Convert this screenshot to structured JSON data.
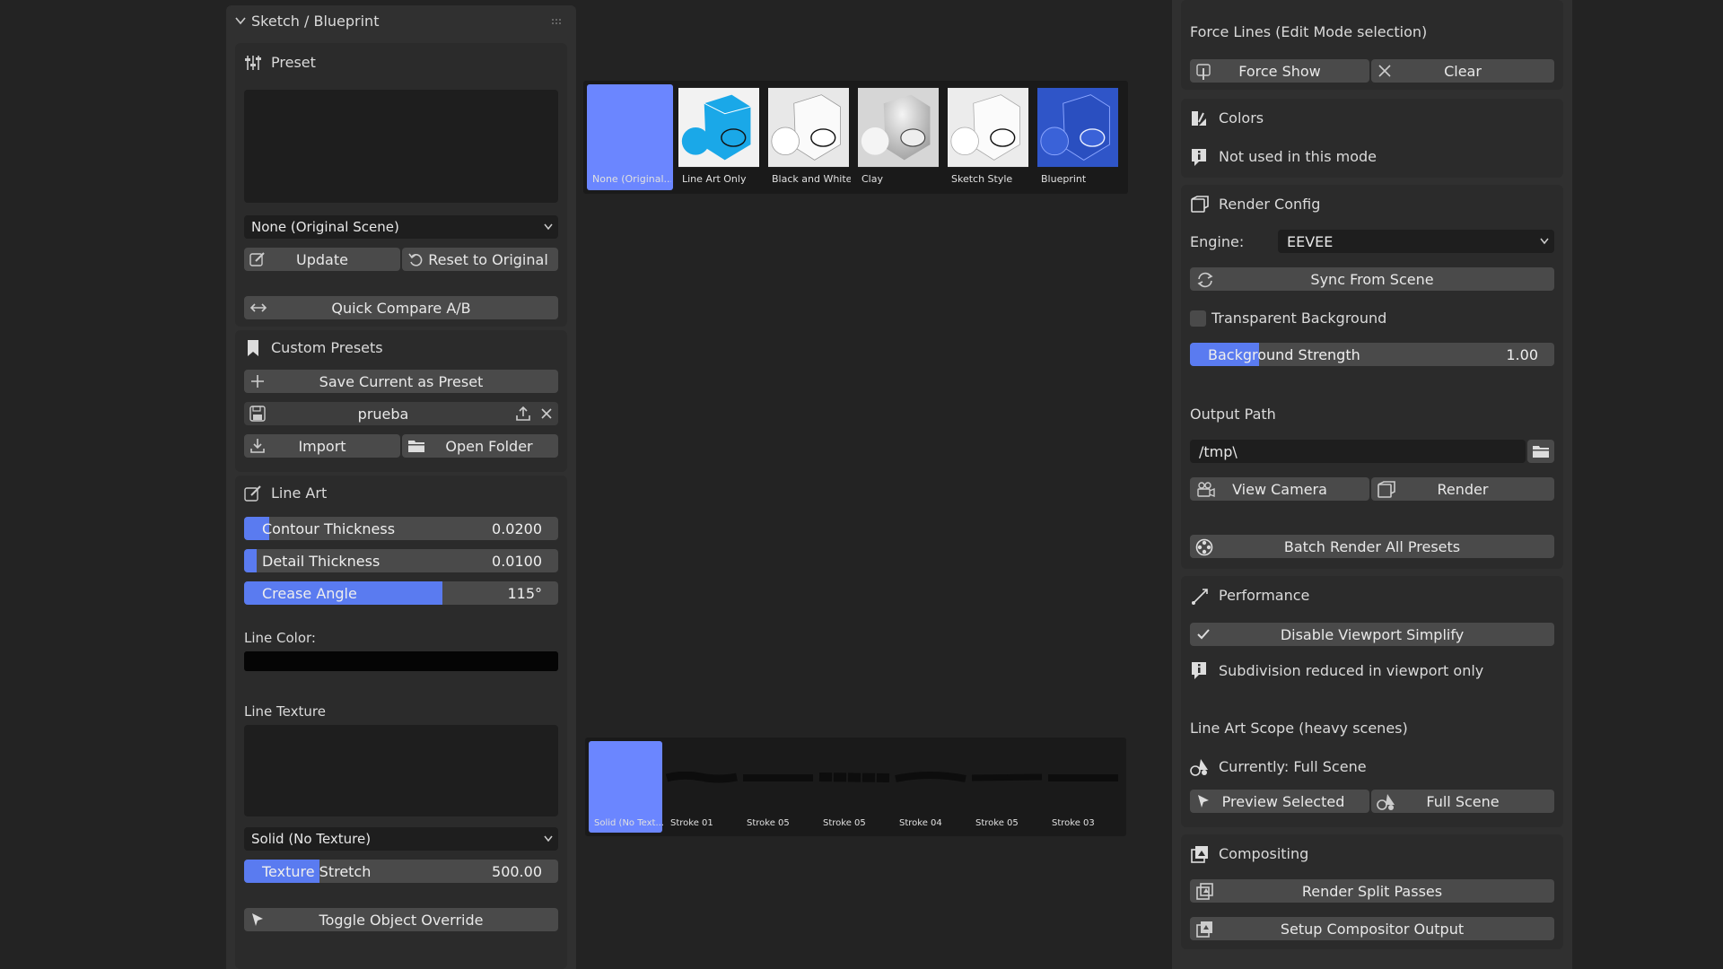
{
  "left_panel": {
    "title": "Sketch / Blueprint",
    "preset": {
      "header": "Preset",
      "dropdown_value": "None (Original Scene)",
      "update_label": "Update",
      "reset_label": "Reset to Original",
      "compare_label": "Quick Compare A/B"
    },
    "custom_presets": {
      "header": "Custom Presets",
      "save_label": "Save Current as Preset",
      "preset_name": "prueba",
      "import_label": "Import",
      "open_folder_label": "Open Folder"
    },
    "line_art": {
      "header": "Line Art",
      "sliders": [
        {
          "label": "Contour Thickness",
          "value": "0.0200",
          "fraction": 0.08
        },
        {
          "label": "Detail Thickness",
          "value": "0.0100",
          "fraction": 0.04
        },
        {
          "label": "Crease Angle",
          "value": "115°",
          "fraction": 0.63
        }
      ],
      "line_color_label": "Line Color:",
      "line_color": "#050505",
      "line_texture_label": "Line Texture",
      "texture_dropdown": "Solid (No Texture)",
      "texture_stretch": {
        "label": "Texture Stretch",
        "value": "500.00",
        "fraction": 0.24
      },
      "toggle_override_label": "Toggle Object Override"
    }
  },
  "preset_thumbnails": [
    {
      "caption": "None (Original...",
      "selected": true,
      "style": "none"
    },
    {
      "caption": "Line Art Only",
      "selected": false,
      "style": "lineart"
    },
    {
      "caption": "Black and White",
      "selected": false,
      "style": "bw"
    },
    {
      "caption": "Clay",
      "selected": false,
      "style": "clay"
    },
    {
      "caption": "Sketch Style",
      "selected": false,
      "style": "sketch"
    },
    {
      "caption": "Blueprint",
      "selected": false,
      "style": "blueprint"
    }
  ],
  "stroke_thumbnails": [
    {
      "caption": "Solid (No Text...",
      "selected": true
    },
    {
      "caption": "Stroke 01",
      "selected": false
    },
    {
      "caption": "Stroke 05",
      "selected": false
    },
    {
      "caption": "Stroke 05",
      "selected": false
    },
    {
      "caption": "Stroke 04",
      "selected": false
    },
    {
      "caption": "Stroke 05",
      "selected": false
    },
    {
      "caption": "Stroke 03",
      "selected": false
    }
  ],
  "right_panel": {
    "force_lines": {
      "header": "Force Lines (Edit Mode selection)",
      "force_show_label": "Force Show",
      "clear_label": "Clear"
    },
    "colors": {
      "header": "Colors",
      "info": "Not used in this mode"
    },
    "render_config": {
      "header": "Render Config",
      "engine_label": "Engine:",
      "engine_value": "EEVEE",
      "sync_label": "Sync From Scene",
      "transparent_label": "Transparent Background",
      "bg_strength": {
        "label": "Background Strength",
        "value": "1.00",
        "fraction": 0.19
      },
      "output_path_label": "Output Path",
      "output_path_value": "/tmp\\",
      "view_camera_label": "View Camera",
      "render_label": "Render",
      "batch_label": "Batch Render All Presets"
    },
    "performance": {
      "header": "Performance",
      "disable_simplify_label": "Disable Viewport Simplify",
      "info": "Subdivision reduced in viewport only",
      "scope_label": "Line Art Scope (heavy scenes)",
      "currently_label": "Currently: Full Scene",
      "preview_selected_label": "Preview Selected",
      "full_scene_label": "Full Scene"
    },
    "compositing": {
      "header": "Compositing",
      "split_passes_label": "Render Split Passes",
      "compositor_output_label": "Setup Compositor Output"
    }
  },
  "colors": {
    "accent": "#5a7bf0",
    "selected_thumb": "#6b86ff",
    "blueprint_blue": "#2f55c8",
    "lineart_cyan": "#1aa8e8"
  }
}
